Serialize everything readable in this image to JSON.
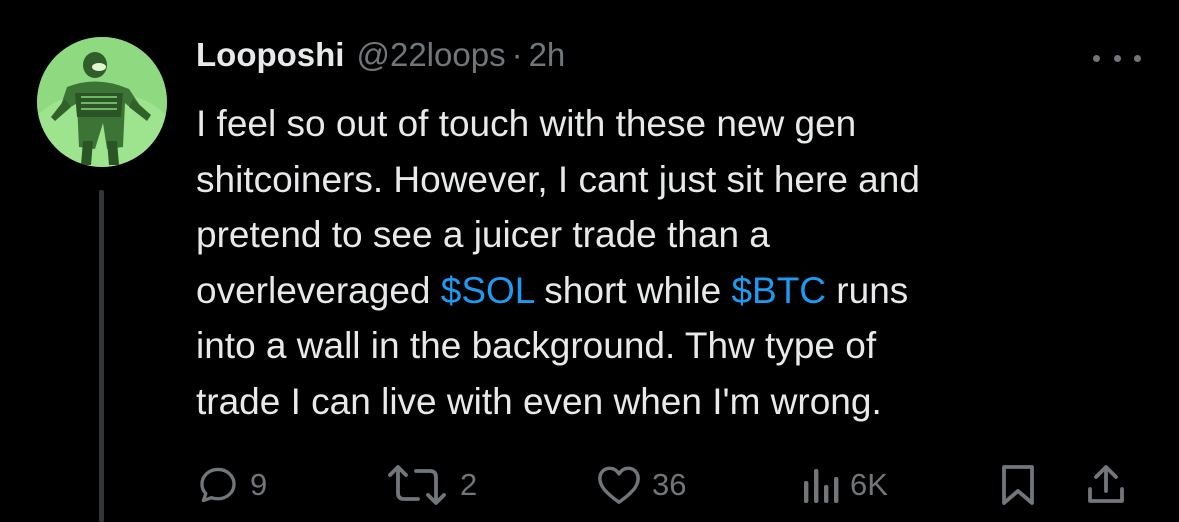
{
  "tweet": {
    "author": {
      "display_name": "Looposhi",
      "handle": "@22loops",
      "separator": "·",
      "time": "2h",
      "avatar_icon": "green-armored-figure-avatar"
    },
    "text_lines": [
      [
        {
          "t": "I feel so out of touch with these new gen"
        }
      ],
      [
        {
          "t": "shitcoiners. However, I cant just sit here and"
        }
      ],
      [
        {
          "t": "pretend to see a juicer trade than a"
        }
      ],
      [
        {
          "t": "overleveraged "
        },
        {
          "t": "$SOL",
          "tag": true
        },
        {
          "t": " short while "
        },
        {
          "t": "$BTC",
          "tag": true
        },
        {
          "t": " runs"
        }
      ],
      [
        {
          "t": "into a wall in the background. Thw type of"
        }
      ],
      [
        {
          "t": "trade I can live with even when I'm wrong."
        }
      ]
    ],
    "actions": {
      "reply": {
        "icon": "reply-icon",
        "count": "9"
      },
      "retweet": {
        "icon": "retweet-icon",
        "count": "2"
      },
      "like": {
        "icon": "heart-icon",
        "count": "36"
      },
      "views": {
        "icon": "views-chart-icon",
        "count": "6K"
      },
      "bookmark": {
        "icon": "bookmark-icon"
      },
      "share": {
        "icon": "share-icon"
      }
    },
    "more_icon": "more-options-icon"
  },
  "colors": {
    "background": "#000000",
    "text_primary": "#e7e9ea",
    "text_secondary": "#71767b",
    "link": "#1d9bf0",
    "avatar_tint": "#8bd67c"
  }
}
